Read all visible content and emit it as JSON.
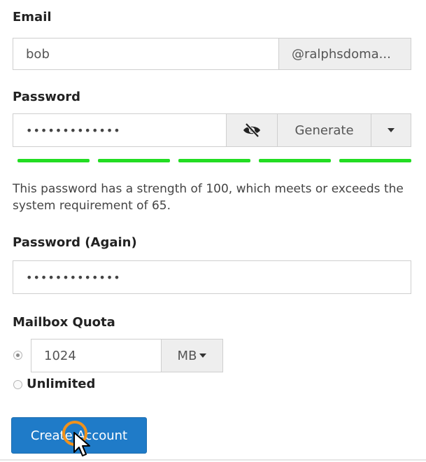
{
  "email": {
    "label": "Email",
    "value": "bob",
    "domain_addon": "@ralphsdoma..."
  },
  "password": {
    "label": "Password",
    "masked_value": "•••••••••••••",
    "visibility_icon": "eye-slash-icon",
    "generate_label": "Generate",
    "dropdown_icon": "caret-down-icon",
    "strength_color": "#22dd22",
    "strength_segments": 5,
    "help_text": "This password has a strength of 100, which meets or exceeds the system requirement of 65."
  },
  "password_again": {
    "label": "Password (Again)",
    "masked_value": "•••••••••••••"
  },
  "quota": {
    "label": "Mailbox Quota",
    "value": "1024",
    "unit": "MB",
    "unlimited_label": "Unlimited",
    "selected": "value"
  },
  "actions": {
    "create_label": "Create Account",
    "primary_color": "#1f7bc8"
  }
}
